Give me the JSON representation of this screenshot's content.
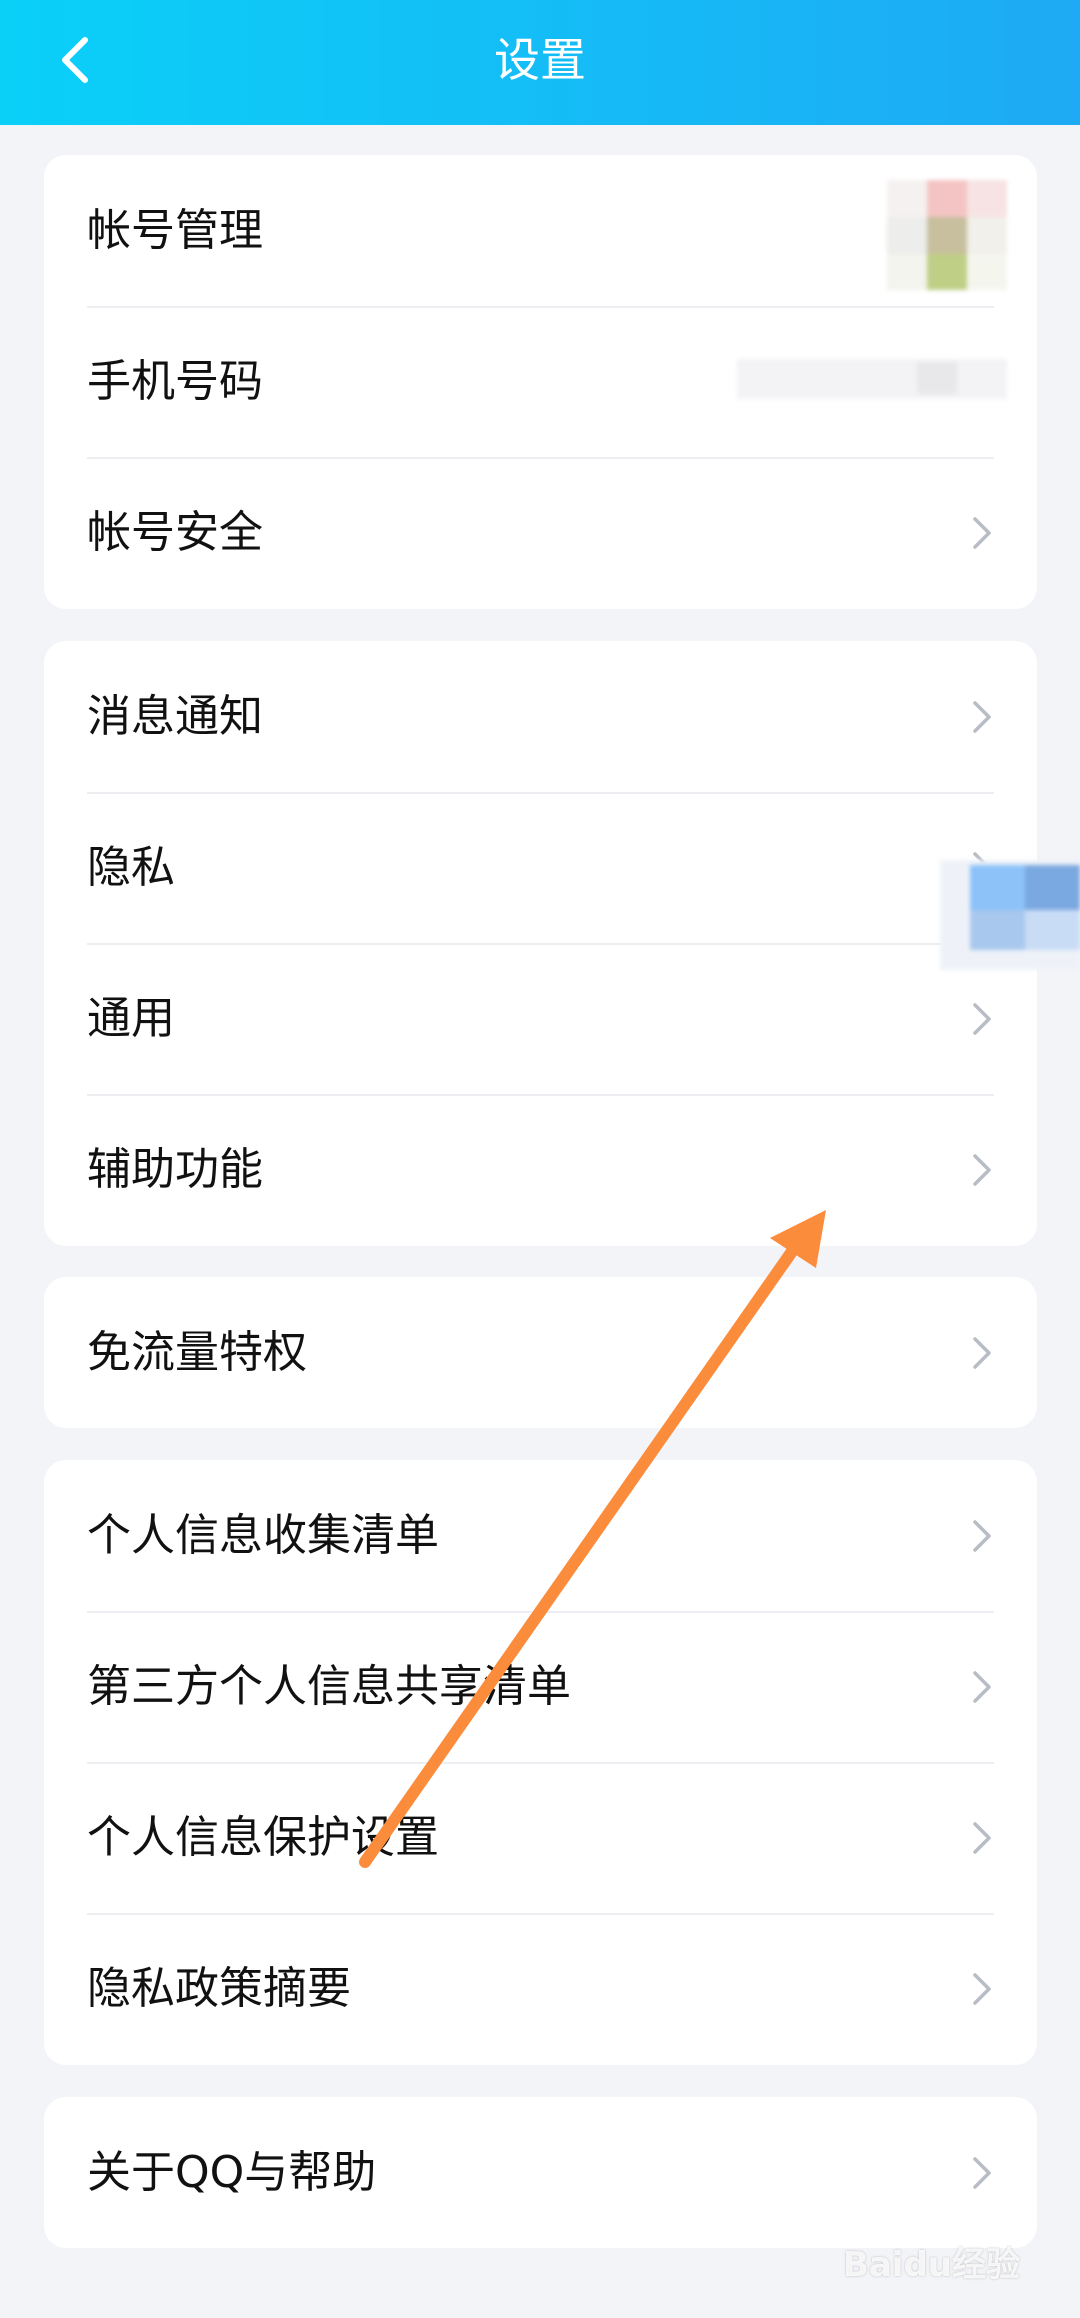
{
  "header": {
    "title": "设置",
    "back_icon": "chevron-left-icon"
  },
  "groups": [
    {
      "items": [
        {
          "label": "帐号管理",
          "chevron": false
        },
        {
          "label": "手机号码",
          "chevron": false
        },
        {
          "label": "帐号安全",
          "chevron": true
        }
      ]
    },
    {
      "items": [
        {
          "label": "消息通知",
          "chevron": true
        },
        {
          "label": "隐私",
          "chevron": true
        },
        {
          "label": "通用",
          "chevron": true
        },
        {
          "label": "辅助功能",
          "chevron": true
        }
      ]
    },
    {
      "items": [
        {
          "label": "免流量特权",
          "chevron": true
        }
      ]
    },
    {
      "items": [
        {
          "label": "个人信息收集清单",
          "chevron": true
        },
        {
          "label": "第三方个人信息共享清单",
          "chevron": true
        },
        {
          "label": "个人信息保护设置",
          "chevron": true
        },
        {
          "label": "隐私政策摘要",
          "chevron": true
        }
      ]
    },
    {
      "items": [
        {
          "label": "关于QQ与帮助",
          "chevron": true
        }
      ]
    }
  ],
  "annotation": {
    "type": "arrow",
    "color": "#fb8c3c"
  },
  "watermark": "Baidu经验",
  "colors": {
    "header_start": "#0ad0f8",
    "header_end": "#1eaaf4",
    "background": "#f3f4f8",
    "card": "#ffffff",
    "chevron": "#b8bcc4"
  }
}
